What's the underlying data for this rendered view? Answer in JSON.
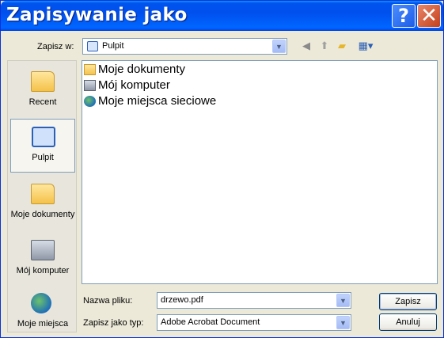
{
  "window": {
    "title": "Zapisywanie jako"
  },
  "titlebar": {
    "help_label": "?",
    "close_label": "✕"
  },
  "lookin": {
    "label": "Zapisz w:",
    "value": "Pulpit"
  },
  "toolbar": {
    "icons": [
      "back-icon",
      "up-folder-icon",
      "new-folder-icon",
      "views-menu-icon"
    ]
  },
  "places": {
    "items": [
      {
        "label": "Recent",
        "icon": "recent-folder-icon"
      },
      {
        "label": "Pulpit",
        "icon": "desktop-icon"
      },
      {
        "label": "Moje dokumenty",
        "icon": "my-documents-icon"
      },
      {
        "label": "Mój komputer",
        "icon": "my-computer-icon"
      },
      {
        "label": "Moje miejsca",
        "icon": "network-places-icon"
      }
    ]
  },
  "files": {
    "items": [
      {
        "name": "Moje dokumenty",
        "icon": "folder-icon"
      },
      {
        "name": "Mój komputer",
        "icon": "computer-icon"
      },
      {
        "name": "Moje miejsca sieciowe",
        "icon": "network-icon"
      }
    ]
  },
  "filename": {
    "label": "Nazwa pliku:",
    "value": "drzewo.pdf"
  },
  "filetype": {
    "label": "Zapisz jako typ:",
    "value": "Adobe Acrobat Document"
  },
  "buttons": {
    "save": "Zapisz",
    "cancel": "Anuluj"
  },
  "colors": {
    "titlebar": "#0053ee",
    "dialog_bg": "#ece9d8",
    "close": "#c4401c"
  }
}
